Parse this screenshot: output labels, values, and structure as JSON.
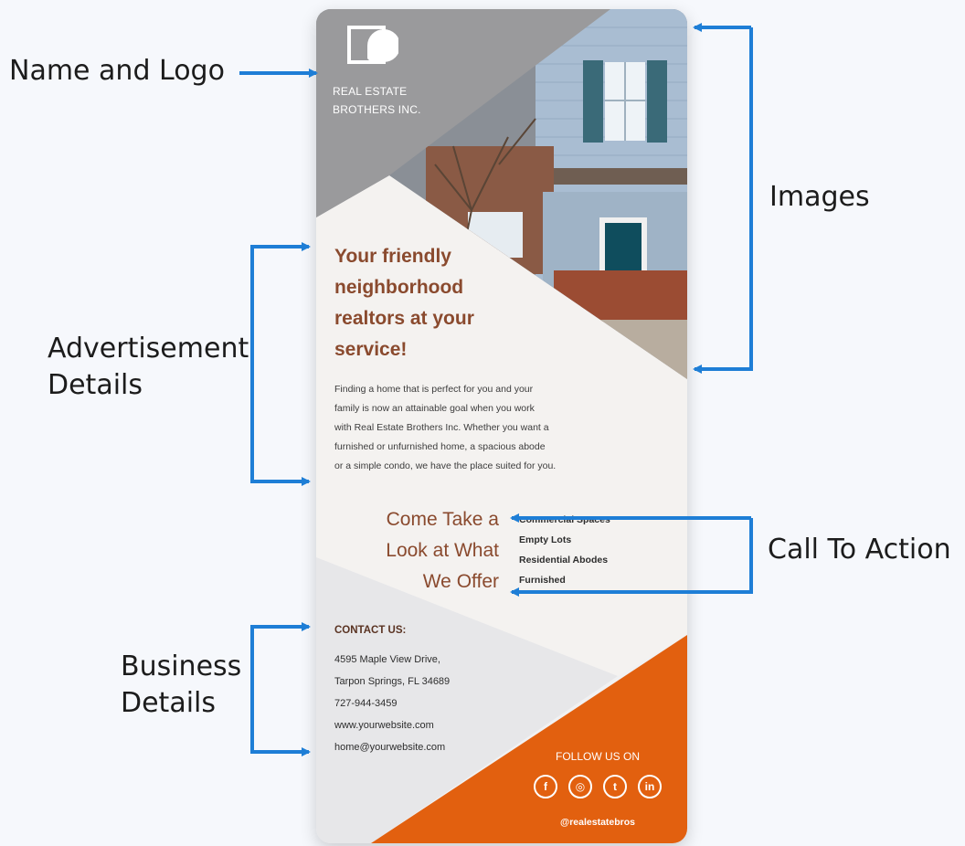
{
  "labels": {
    "name_logo": "Name and Logo",
    "images": "Images",
    "advert_line1": "Advertisement",
    "advert_line2": "Details",
    "call_to_action": "Call To Action",
    "business_line1": "Business",
    "business_line2": "Details"
  },
  "flyer": {
    "brand_line1": "REAL ESTATE",
    "brand_line2": "BROTHERS INC.",
    "headline_lines": [
      "Your friendly",
      "neighborhood",
      "realtors at your",
      "service!"
    ],
    "body_lines": [
      "Finding a home that is perfect for you and your",
      "family is now an attainable goal when you work",
      "with Real Estate Brothers Inc. Whether you want a",
      "furnished or unfurnished home, a spacious abode",
      "or a simple condo, we have the place suited for you."
    ],
    "cta_lines": [
      "Come Take a",
      "Look at What",
      "We Offer"
    ],
    "offers": [
      "Commercial Spaces",
      "Empty Lots",
      "Residential Abodes",
      "Furnished"
    ],
    "contact_title": "CONTACT US:",
    "contact_lines": [
      "4595 Maple View Drive,",
      "Tarpon Springs, FL 34689",
      "727-944-3459",
      "www.yourwebsite.com",
      "home@yourwebsite.com"
    ],
    "follow_title": "FOLLOW US ON",
    "social": [
      {
        "icon": "facebook-icon",
        "glyph": "f"
      },
      {
        "icon": "instagram-icon",
        "glyph": "◎"
      },
      {
        "icon": "twitter-icon",
        "glyph": "t"
      },
      {
        "icon": "linkedin-icon",
        "glyph": "in"
      }
    ],
    "handle": "@realestatebros"
  },
  "colors": {
    "arrow": "#1e7ed6",
    "accent_orange": "#e2600f",
    "header_gray": "#9a9a9c",
    "headline_brown": "#8a4a2e"
  }
}
